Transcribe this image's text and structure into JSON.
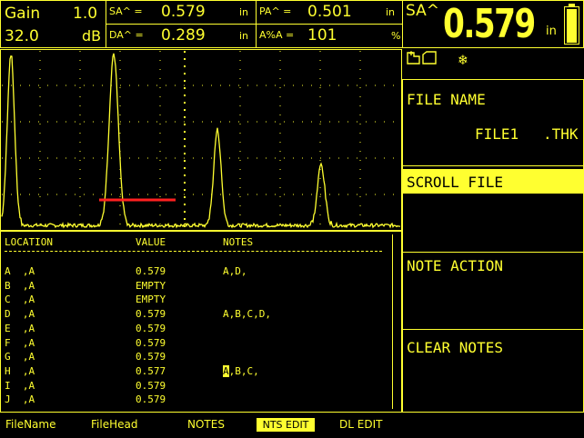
{
  "header": {
    "gain_label": "Gain",
    "gain_step": "1.0",
    "gain_value": "32.0",
    "gain_unit": "dB",
    "sa_label": "SA^ =",
    "sa_value": "0.579",
    "sa_unit": "in",
    "da_label": "DA^ =",
    "da_value": "0.289",
    "da_unit": "in",
    "pa_label": "PA^ =",
    "pa_value": "0.501",
    "pa_unit": "in",
    "aa_label": "A%A =",
    "aa_value": "101",
    "aa_unit": "%",
    "big_label": "SA^",
    "big_value": "0.579",
    "big_unit": "in"
  },
  "status_icons": [
    "file-icon",
    "freeze-icon"
  ],
  "sidebar": {
    "file_name_label": "FILE NAME",
    "file_name_value": "FILE1",
    "file_ext": ".THK",
    "scroll_file": "SCROLL FILE",
    "note_action": "NOTE ACTION",
    "clear_notes": "CLEAR NOTES"
  },
  "table": {
    "headers": [
      "LOCATION",
      "VALUE",
      "NOTES"
    ],
    "rows": [
      {
        "loc": "A  ,A",
        "value": "0.579",
        "notes": "A,D,"
      },
      {
        "loc": "B  ,A",
        "value": "EMPTY",
        "notes": ""
      },
      {
        "loc": "C  ,A",
        "value": "EMPTY",
        "notes": ""
      },
      {
        "loc": "D  ,A",
        "value": "0.579",
        "notes": "A,B,C,D,"
      },
      {
        "loc": "E  ,A",
        "value": "0.579",
        "notes": ""
      },
      {
        "loc": "F  ,A",
        "value": "0.579",
        "notes": ""
      },
      {
        "loc": "G  ,A",
        "value": "0.579",
        "notes": ""
      },
      {
        "loc": "H  ,A",
        "value": "0.577",
        "notes": ",B,C,",
        "cursor": "A"
      },
      {
        "loc": "I  ,A",
        "value": "0.579",
        "notes": ""
      },
      {
        "loc": "J  ,A",
        "value": "0.579",
        "notes": ""
      }
    ]
  },
  "menu": {
    "file_name": "FileName",
    "file_head": "FileHead",
    "notes": "NOTES",
    "nts_edit": "NTS EDIT",
    "dl_edit": "DL EDIT"
  },
  "colors": {
    "foreground": "#ffff30",
    "background": "#000000",
    "gate": "#ff2020"
  }
}
